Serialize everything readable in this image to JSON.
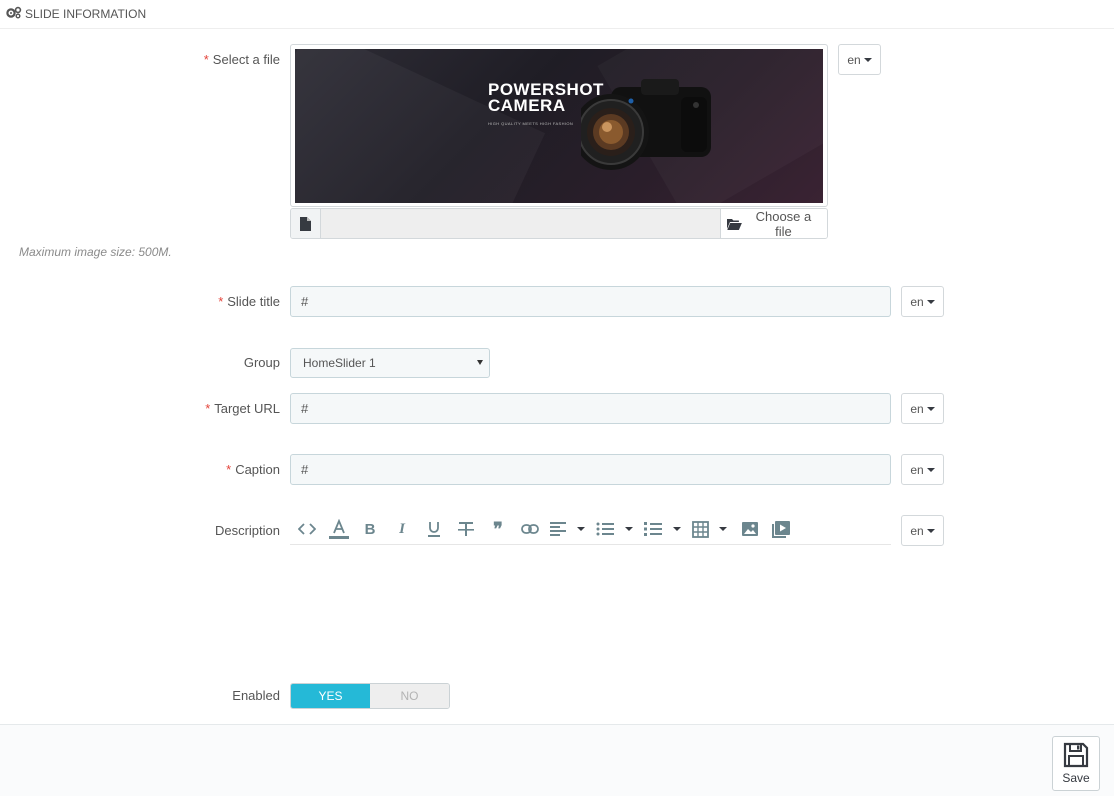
{
  "header": {
    "title": "SLIDE INFORMATION",
    "icon": "cogs-icon"
  },
  "fields": {
    "file": {
      "label": "Select a file",
      "required_mark": "*",
      "lang": "en",
      "banner_title_line1": "POWERSHOT",
      "banner_title_line2": "CAMERA",
      "banner_subtitle": "HIGH QUALITY MEETS HIGH FASHION",
      "file_name": "",
      "choose_label": "Choose a file",
      "help": "Maximum image size: 500M."
    },
    "slide_title": {
      "label": "Slide title",
      "required_mark": "*",
      "value": "#",
      "lang": "en"
    },
    "group": {
      "label": "Group",
      "selected": "HomeSlider 1"
    },
    "target_url": {
      "label": "Target URL",
      "required_mark": "*",
      "value": "#",
      "lang": "en"
    },
    "caption": {
      "label": "Caption",
      "required_mark": "*",
      "value": "#",
      "lang": "en"
    },
    "description": {
      "label": "Description",
      "lang": "en",
      "toolbar": [
        "code-view-icon",
        "font-color-icon",
        "bold-icon",
        "italic-icon",
        "underline-icon",
        "strikethrough-icon",
        "blockquote-icon",
        "link-icon",
        "align-left-icon",
        "bullet-list-icon",
        "numbered-list-icon",
        "table-icon",
        "image-icon",
        "video-icon"
      ]
    },
    "enabled": {
      "label": "Enabled",
      "yes": "YES",
      "no": "NO",
      "value": "YES"
    }
  },
  "footer": {
    "save_label": "Save"
  },
  "colors": {
    "accent": "#25b9d7",
    "required": "#e4433a",
    "input_bg": "#f5f8f9"
  }
}
